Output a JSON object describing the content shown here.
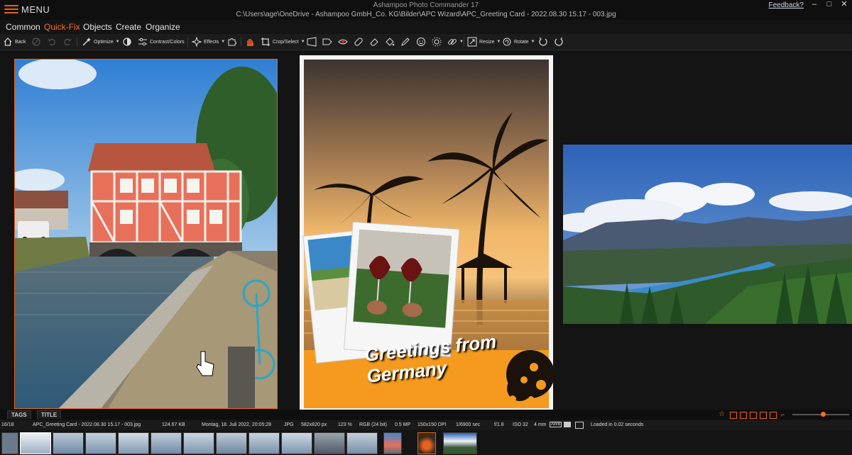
{
  "titlebar": {
    "menu_label": "MENU",
    "app_title": "Ashampoo Photo Commander 17",
    "file_path": "C:\\Users\\age\\OneDrive - Ashampoo GmbH_Co. KG\\Bilder\\APC Wizard\\APC_Greeting Card - 2022.08.30 15.17 - 003.jpg",
    "feedback": "Feedback?",
    "minimize": "–",
    "maximize": "□",
    "close": "✕"
  },
  "tabs": [
    {
      "label": "Common",
      "active": false
    },
    {
      "label": "Quick-Fix",
      "active": true
    },
    {
      "label": "Objects",
      "active": false
    },
    {
      "label": "Create",
      "active": false
    },
    {
      "label": "Organize",
      "active": false
    }
  ],
  "toolbar": {
    "back": "Back",
    "optimize": "Optimize",
    "contrast_colors": "Contrast/Colors",
    "effects": "Effects",
    "crop_select": "Crop/Select",
    "resize": "Resize",
    "rotate": "Rotate"
  },
  "card": {
    "greeting_line1": "Greetings from",
    "greeting_line2": "Germany"
  },
  "bottom_tabs": {
    "tags": "TAGS",
    "title": "TITLE"
  },
  "status": {
    "index": "16/18",
    "filename": "APC_Greeting Card - 2022.08.30 15.17 - 003.jpg",
    "filesize": "124.67 KB",
    "date": "Montag, 18. Juli 2022, 20:05:28",
    "format": "JPG",
    "dimensions": "582x820 px",
    "zoom": "123 %",
    "color": "RGB (24 bit)",
    "megapixels": "0.5 MP",
    "dpi": "150x150 DPI",
    "exposure": "1/6900 sec",
    "aperture": "f/1.8",
    "iso": "ISO 32",
    "focal": "4 mm",
    "awb": "AWB",
    "loaded": "Loaded in 0.02 seconds"
  },
  "colors": {
    "accent": "#ff6a25",
    "background": "#141414",
    "selection_border": "#e8621c"
  }
}
